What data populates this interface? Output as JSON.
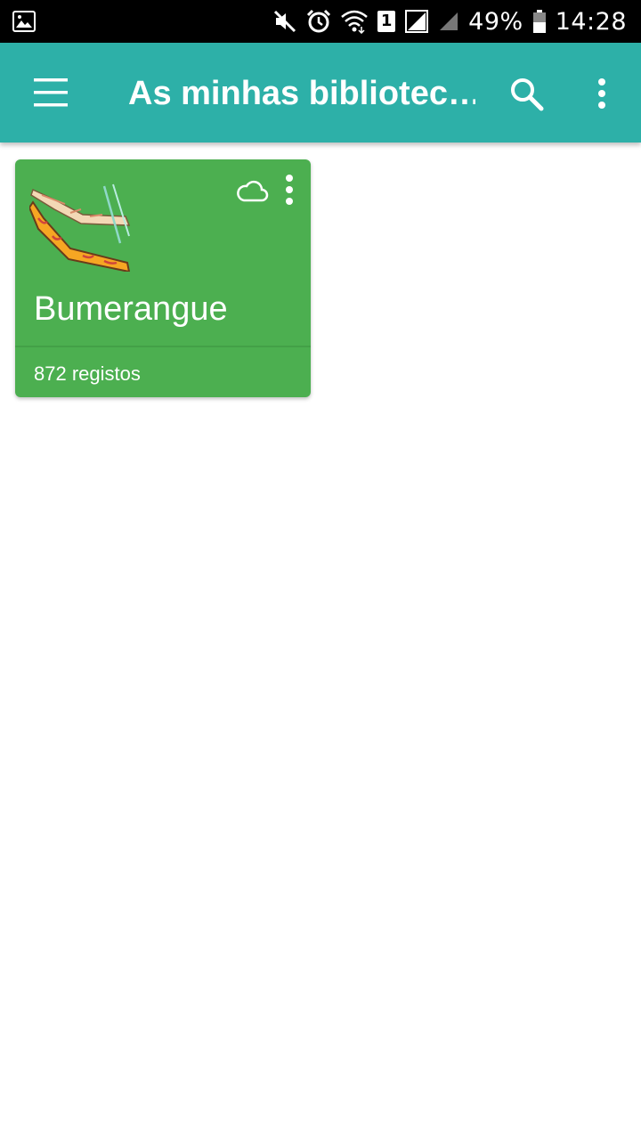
{
  "status_bar": {
    "battery": "49%",
    "time": "14:28",
    "sim_slot": "1",
    "icons": [
      "image-notification-icon",
      "mute-icon",
      "alarm-icon",
      "wifi-icon",
      "sim-1-icon",
      "signal-icon",
      "battery-icon"
    ]
  },
  "app_bar": {
    "title": "As minhas bibliotec…",
    "menu_icon": "hamburger-menu-icon",
    "search_icon": "search-icon",
    "overflow_icon": "more-vert-icon",
    "color": "#2db0a8"
  },
  "libraries": [
    {
      "name": "Bumerangue",
      "count_label": "872 registos",
      "image": "boomerang-image",
      "cloud_icon": "cloud-icon",
      "overflow_icon": "more-vert-icon",
      "color": "#4caf50"
    }
  ]
}
